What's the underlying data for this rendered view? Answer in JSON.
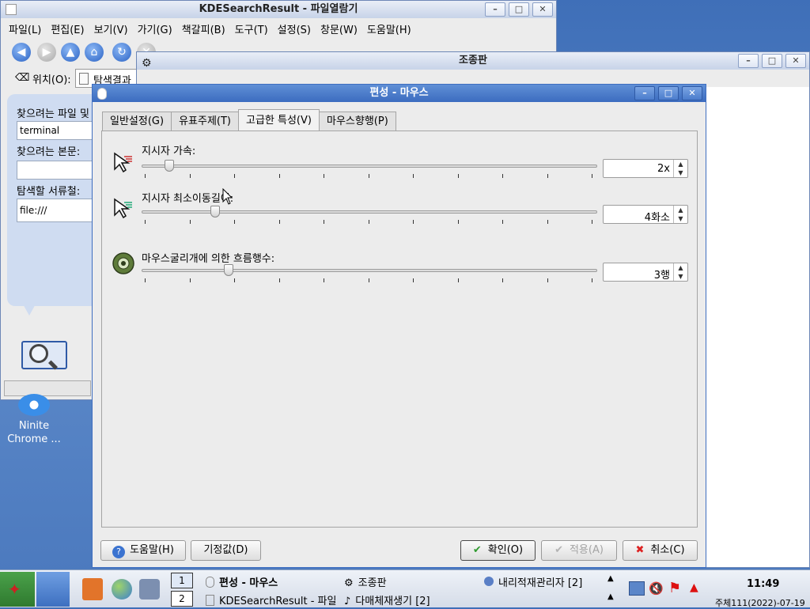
{
  "file_manager": {
    "title": "KDESearchResult - 파일열람기",
    "menu": [
      "파일(L)",
      "편집(E)",
      "보기(V)",
      "가기(G)",
      "책갈피(B)",
      "도구(T)",
      "설정(S)",
      "창문(W)",
      "도움말(H)"
    ],
    "location_label": "위치(O):",
    "location_value": "탐색결과",
    "search_file_label": "찾으려는 파일 및",
    "search_file_value": "terminal",
    "search_text_label": "찾으려는 본문:",
    "search_text_value": "",
    "search_dir_label": "탐색할 서류철:",
    "search_dir_value": "file:///"
  },
  "control_panel": {
    "title": "조종판"
  },
  "dialog": {
    "title": "편성 - 마우스",
    "tabs": [
      "일반설정(G)",
      "유표주제(T)",
      "고급한 특성(V)",
      "마우스향행(P)"
    ],
    "selected_tab": 2,
    "rows": [
      {
        "label": "지시자 가속:",
        "value": "2x",
        "slider_fraction": 0.06
      },
      {
        "label": "지시자 최소이동길이:",
        "value": "4화소",
        "slider_fraction": 0.16
      },
      {
        "label": "마우스굴리개에 의한 흐름행수:",
        "value": "3행",
        "slider_fraction": 0.19
      }
    ],
    "buttons": {
      "help": "도움말(H)",
      "defaults": "기정값(D)",
      "ok": "확인(O)",
      "apply": "적용(A)",
      "cancel": "취소(C)"
    }
  },
  "desktop": {
    "icon_label": "Ninite Chrome ..."
  },
  "taskbar": {
    "pager": [
      "1",
      "2"
    ],
    "tasks": [
      "편성 - 마우스",
      "조종판",
      "내리적재관리자 [2]",
      "KDESearchResult - 파일",
      "다매체재생기 [2]"
    ],
    "clock_time": "11:49",
    "clock_date": "주체111(2022)-07-19"
  }
}
